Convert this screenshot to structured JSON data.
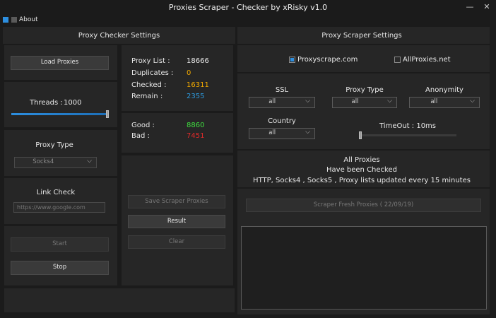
{
  "window": {
    "title": "Proxies Scraper - Checker by xRisky v1.0",
    "minimize": "—",
    "close": "✕"
  },
  "menu": {
    "about": "About"
  },
  "checker": {
    "heading": "Proxy Checker Settings",
    "load_proxies": "Load Proxies",
    "threads_label": "Threads :",
    "threads_value": "1000",
    "threads_level": 1.0,
    "proxy_type_label": "Proxy Type",
    "proxy_type_value": "Socks4",
    "link_check_label": "Link Check",
    "link_check_placeholder": "https://www.google.com",
    "start": "Start",
    "stop": "Stop"
  },
  "stats": {
    "proxy_list_label": "Proxy List :",
    "proxy_list_value": "18666",
    "duplicates_label": "Duplicates :",
    "duplicates_value": "0",
    "checked_label": "Checked :",
    "checked_value": "16311",
    "remain_label": "Remain :",
    "remain_value": "2355",
    "good_label": "Good :",
    "good_value": "8860",
    "bad_label": "Bad :",
    "bad_value": "7451",
    "save_scraper": "Save Scraper Proxies",
    "result": "Result",
    "clear": "Clear"
  },
  "scraper": {
    "heading": "Proxy Scraper Settings",
    "source1": "Proxyscrape.com",
    "source1_checked": true,
    "source2": "AllProxies.net",
    "source2_checked": false,
    "ssl_label": "SSL",
    "ssl_value": "all",
    "proxy_type_label": "Proxy Type",
    "proxy_type_value": "all",
    "anonymity_label": "Anonymity",
    "anonymity_value": "all",
    "country_label": "Country",
    "country_value": "all",
    "timeout_label": "TimeOut : 10ms",
    "timeout_level": 0.0,
    "info_line1": "All Proxies",
    "info_line2": "Have been Checked",
    "info_line3": "HTTP, Socks4 , Socks5 , Proxy lists updated every 15 minutes",
    "fresh_button": "Scraper Fresh Proxies ( 22/09/19)"
  },
  "colors": {
    "accent": "#2d8fe0",
    "duplicates": "#f0a800",
    "checked": "#f0a800",
    "remain": "#2d9be0",
    "good": "#3fdc3f",
    "bad": "#e02a2a"
  }
}
